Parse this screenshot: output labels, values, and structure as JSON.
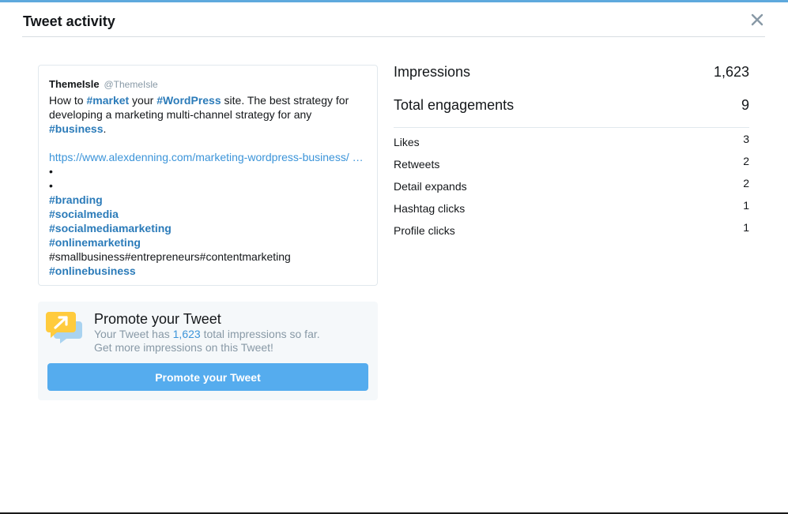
{
  "modal": {
    "title": "Tweet activity",
    "close_icon": "close-icon"
  },
  "tweet": {
    "author_name": "ThemeIsle",
    "author_handle": "@ThemeIsle",
    "text_line1_a": "How to ",
    "text_line1_hashtag1": "#market",
    "text_line1_b": " your ",
    "text_line1_hashtag2": "#WordPress",
    "text_line1_c": " site. The best strategy for",
    "text_line2": "developing a marketing multi-channel strategy for any",
    "text_line3_hashtag": "#business",
    "text_line3_period": ".",
    "link": "https://www.alexdenning.com/marketing-wordpress-business/ …",
    "bullet1": "•",
    "bullet2": "•",
    "hashtag_branding": "#branding",
    "hashtag_socialmedia": "#socialmedia",
    "hashtag_socialmediamarketing": "#socialmediamarketing",
    "hashtag_onlinemarketing": "#onlinemarketing",
    "plain_tags": "#smallbusiness#entrepreneurs#contentmarketing",
    "hashtag_onlinebusiness": "#onlinebusiness"
  },
  "promote": {
    "icon": "promote-arrow-icon",
    "title": "Promote your Tweet",
    "desc_a": "Your Tweet has ",
    "desc_num": "1,623",
    "desc_b": " total impressions so far.",
    "desc_line2": "Get more impressions on this Tweet!",
    "button_label": "Promote your Tweet"
  },
  "stats": {
    "impressions_label": "Impressions",
    "impressions_value": "1,623",
    "engagements_label": "Total engagements",
    "engagements_value": "9",
    "breakdown": [
      {
        "label": "Likes",
        "value": "3"
      },
      {
        "label": "Retweets",
        "value": "2"
      },
      {
        "label": "Detail expands",
        "value": "2"
      },
      {
        "label": "Hashtag clicks",
        "value": "1"
      },
      {
        "label": "Profile clicks",
        "value": "1"
      }
    ]
  },
  "colors": {
    "accent": "#5ea9dd",
    "button": "#55acee",
    "hashtag": "#2b7bb9",
    "link": "#3b94d9",
    "muted": "#8899a6"
  }
}
